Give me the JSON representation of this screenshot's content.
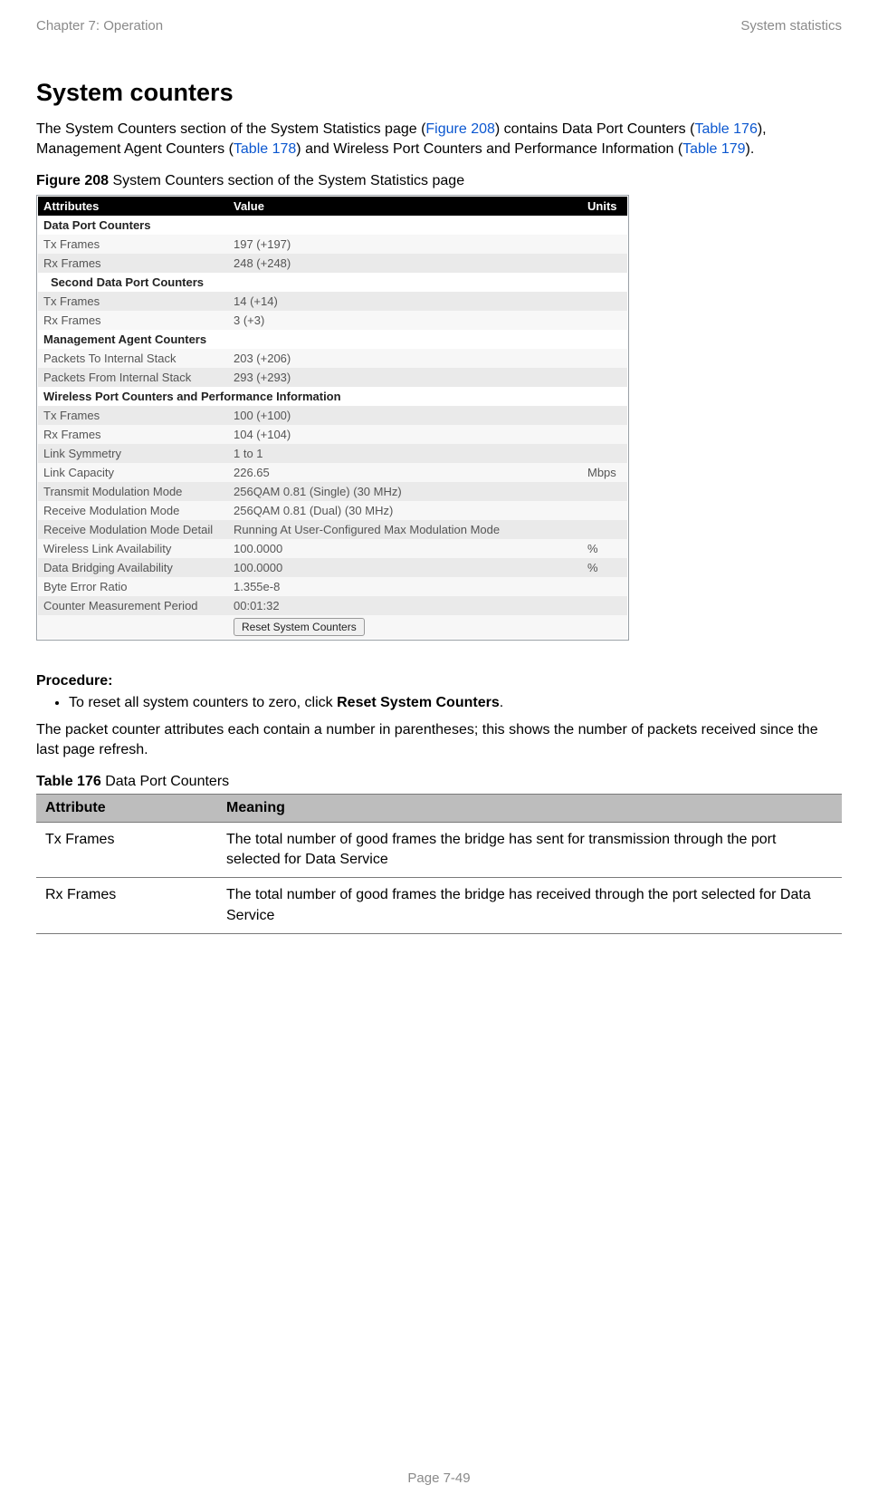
{
  "header": {
    "left": "Chapter 7:  Operation",
    "right": "System statistics"
  },
  "title": "System counters",
  "intro": {
    "t1": "The System Counters section of the System Statistics page (",
    "l1": "Figure 208",
    "t2": ") contains Data Port Counters (",
    "l2": "Table 176",
    "t3": "), Management Agent Counters (",
    "l3": "Table 178",
    "t4": ") and Wireless Port Counters and Performance Information (",
    "l4": "Table 179",
    "t5": ")."
  },
  "figcap": {
    "b": "Figure 208",
    "r": " System Counters section of the System Statistics page"
  },
  "stats": {
    "head": {
      "a": "Attributes",
      "v": "Value",
      "u": "Units"
    },
    "s1": "Data Port Counters",
    "r1": {
      "a": "Tx Frames",
      "v": "197 (+197)",
      "u": ""
    },
    "r2": {
      "a": "Rx Frames",
      "v": "248 (+248)",
      "u": ""
    },
    "s2": "Second Data Port Counters",
    "r3": {
      "a": "Tx Frames",
      "v": "14 (+14)",
      "u": ""
    },
    "r4": {
      "a": "Rx Frames",
      "v": "3 (+3)",
      "u": ""
    },
    "s3": "Management Agent Counters",
    "r5": {
      "a": "Packets To Internal Stack",
      "v": "203 (+206)",
      "u": ""
    },
    "r6": {
      "a": "Packets From Internal Stack",
      "v": "293 (+293)",
      "u": ""
    },
    "s4": "Wireless Port Counters and Performance Information",
    "r7": {
      "a": "Tx Frames",
      "v": "100 (+100)",
      "u": ""
    },
    "r8": {
      "a": "Rx Frames",
      "v": "104 (+104)",
      "u": ""
    },
    "r9": {
      "a": "Link Symmetry",
      "v": "1 to 1",
      "u": ""
    },
    "r10": {
      "a": "Link Capacity",
      "v": "226.65",
      "u": "Mbps"
    },
    "r11": {
      "a": "Transmit Modulation Mode",
      "v": "256QAM 0.81 (Single) (30 MHz)",
      "u": ""
    },
    "r12": {
      "a": "Receive Modulation Mode",
      "v": "256QAM 0.81 (Dual) (30 MHz)",
      "u": ""
    },
    "r13": {
      "a": "Receive Modulation Mode Detail",
      "v": "Running At User-Configured Max Modulation Mode",
      "u": ""
    },
    "r14": {
      "a": "Wireless Link Availability",
      "v": "100.0000",
      "u": "%"
    },
    "r15": {
      "a": "Data Bridging Availability",
      "v": "100.0000",
      "u": "%"
    },
    "r16": {
      "a": "Byte Error Ratio",
      "v": "1.355e-8",
      "u": ""
    },
    "r17": {
      "a": "Counter Measurement Period",
      "v": "00:01:32",
      "u": ""
    },
    "btn": "Reset System Counters"
  },
  "procedure": {
    "label": "Procedure:",
    "bullet_pre": "To reset all system counters to zero, click ",
    "bullet_bold": "Reset System Counters",
    "bullet_post": "."
  },
  "note": "The packet counter attributes each contain a number in parentheses; this shows the number of packets received since the last page refresh.",
  "tblcap": {
    "b": "Table 176",
    "r": "  Data Port Counters"
  },
  "defs": {
    "h1": "Attribute",
    "h2": "Meaning",
    "rows": [
      {
        "a": "Tx Frames",
        "m": "The total number of good frames the bridge has sent for transmission through the port selected for Data Service"
      },
      {
        "a": "Rx Frames",
        "m": "The total number of good frames the bridge has received through the port selected for Data Service"
      }
    ]
  },
  "footer": "Page 7-49"
}
